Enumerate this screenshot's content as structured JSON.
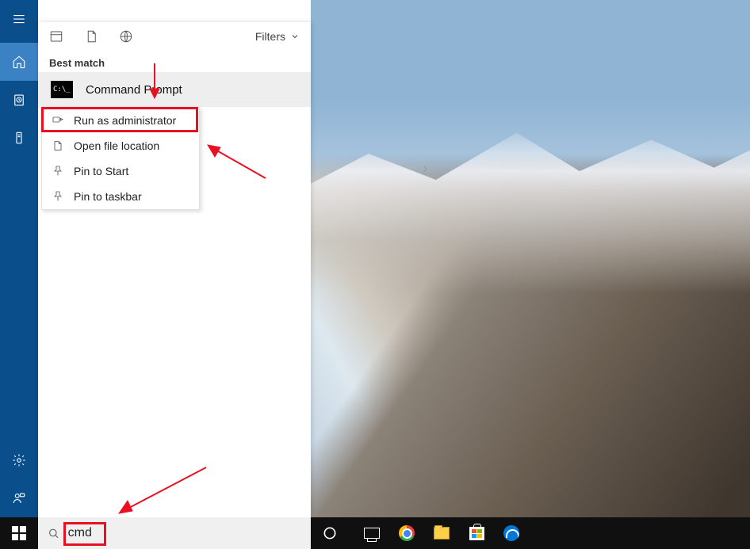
{
  "rail": {
    "items": [
      "menu",
      "home",
      "clock",
      "phone"
    ],
    "bottom": [
      "settings",
      "user"
    ]
  },
  "panel": {
    "filters_label": "Filters",
    "section_label": "Best match",
    "result": {
      "title": "Command Prompt"
    },
    "context": {
      "items": [
        {
          "label": "Run as administrator",
          "highlighted": true
        },
        {
          "label": "Open file location"
        },
        {
          "label": "Pin to Start"
        },
        {
          "label": "Pin to taskbar"
        }
      ]
    }
  },
  "search": {
    "value": "cmd"
  },
  "taskbar_apps": [
    "taskview",
    "chrome",
    "file-explorer",
    "store",
    "edge"
  ]
}
